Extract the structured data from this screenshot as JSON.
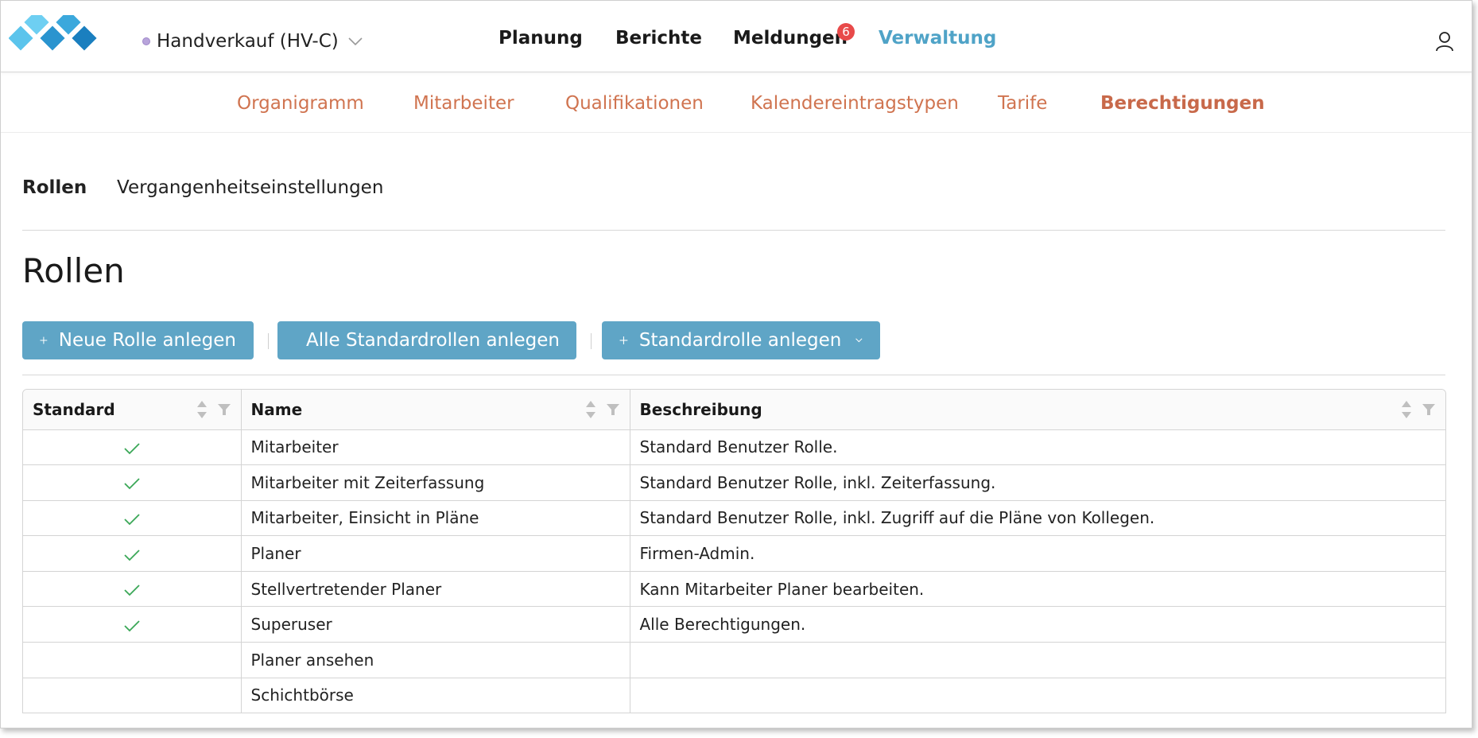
{
  "header": {
    "company": "Handverkauf (HV-C)",
    "nav": [
      {
        "label": "Planung"
      },
      {
        "label": "Berichte"
      },
      {
        "label": "Meldungen",
        "badge": "6"
      },
      {
        "label": "Verwaltung",
        "active": true
      }
    ]
  },
  "subnav": [
    {
      "label": "Organigramm"
    },
    {
      "label": "Mitarbeiter"
    },
    {
      "label": "Qualifikationen"
    },
    {
      "label": "Kalendereintragstypen"
    },
    {
      "label": "Tarife"
    },
    {
      "label": "Berechtigungen",
      "active": true
    }
  ],
  "tabs": [
    {
      "label": "Rollen",
      "active": true
    },
    {
      "label": "Vergangenheitseinstellungen"
    }
  ],
  "page_title": "Rollen",
  "buttons": {
    "new_role": "Neue Rolle anlegen",
    "all_standard": "Alle Standardrollen anlegen",
    "standard_role": "Standardrolle anlegen"
  },
  "table": {
    "columns": [
      "Standard",
      "Name",
      "Beschreibung"
    ],
    "rows": [
      {
        "standard": true,
        "name": "Mitarbeiter",
        "description": "Standard Benutzer Rolle."
      },
      {
        "standard": true,
        "name": "Mitarbeiter mit Zeiterfassung",
        "description": "Standard Benutzer Rolle, inkl. Zeiterfassung."
      },
      {
        "standard": true,
        "name": "Mitarbeiter, Einsicht in Pläne",
        "description": "Standard Benutzer Rolle, inkl. Zugriff auf die Pläne von Kollegen."
      },
      {
        "standard": true,
        "name": "Planer",
        "description": "Firmen-Admin."
      },
      {
        "standard": true,
        "name": "Stellvertretender Planer",
        "description": "Kann Mitarbeiter Planer bearbeiten."
      },
      {
        "standard": true,
        "name": "Superuser",
        "description": "Alle Berechtigungen."
      },
      {
        "standard": false,
        "name": "Planer ansehen",
        "description": ""
      },
      {
        "standard": false,
        "name": "Schichtbörse",
        "description": ""
      }
    ]
  },
  "colors": {
    "accent": "#5fa5c6",
    "active_nav": "#4fa3c7",
    "subnav": "#d07450",
    "badge": "#e84a4a",
    "check": "#3aa757"
  },
  "icons": {
    "logo": "diamond-logo-icon",
    "user": "user-icon",
    "plus": "plus-icon",
    "chevron": "chevron-down-icon",
    "sort": "sort-icon",
    "filter": "filter-icon",
    "check": "checkmark-icon"
  }
}
